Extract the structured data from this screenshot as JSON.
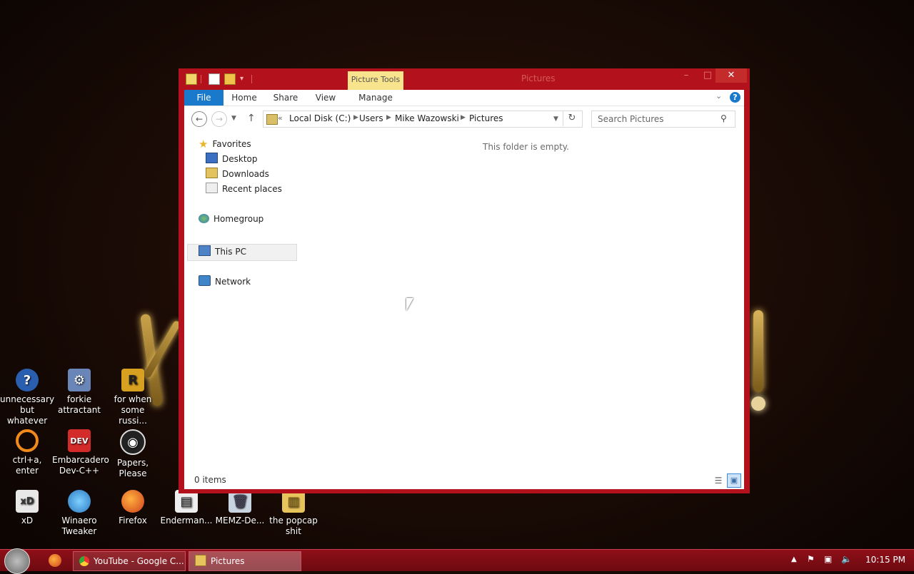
{
  "window": {
    "title": "Pictures",
    "picture_tools_label": "Picture Tools",
    "minimize": "–",
    "maximize": "□",
    "close": "✕"
  },
  "ribbon": {
    "tabs": [
      "File",
      "Home",
      "Share",
      "View",
      "Manage"
    ],
    "help": "?"
  },
  "address": {
    "overflow": "«",
    "crumbs": [
      "Local Disk (C:)",
      "Users",
      "Mike Wazowski",
      "Pictures"
    ]
  },
  "search": {
    "placeholder": "Search Pictures"
  },
  "nav_pane": {
    "favorites": "Favorites",
    "favorites_items": [
      "Desktop",
      "Downloads",
      "Recent places"
    ],
    "homegroup": "Homegroup",
    "this_pc": "This PC",
    "network": "Network"
  },
  "content": {
    "empty_message": "This folder is empty."
  },
  "status": {
    "item_count": "0 items"
  },
  "desktop_icons": [
    {
      "label": "unnecessary but whatever"
    },
    {
      "label": "forkie attractant"
    },
    {
      "label": "for when some russi..."
    },
    {
      "label": "ctrl+a, enter"
    },
    {
      "label": "Embarcadero Dev-C++"
    },
    {
      "label": "Papers, Please"
    },
    {
      "label": "xD"
    },
    {
      "label": "Winaero Tweaker"
    },
    {
      "label": "Firefox"
    },
    {
      "label": "Enderman..."
    },
    {
      "label": "MEMZ-De..."
    },
    {
      "label": "the popcap shit"
    }
  ],
  "taskbar": {
    "tasks": [
      "YouTube - Google C...",
      "Pictures"
    ],
    "clock": "10:15 PM"
  },
  "colors": {
    "accent": "#b3121d",
    "file_tab": "#1979ca",
    "picture_tools": "#f7e48c"
  }
}
